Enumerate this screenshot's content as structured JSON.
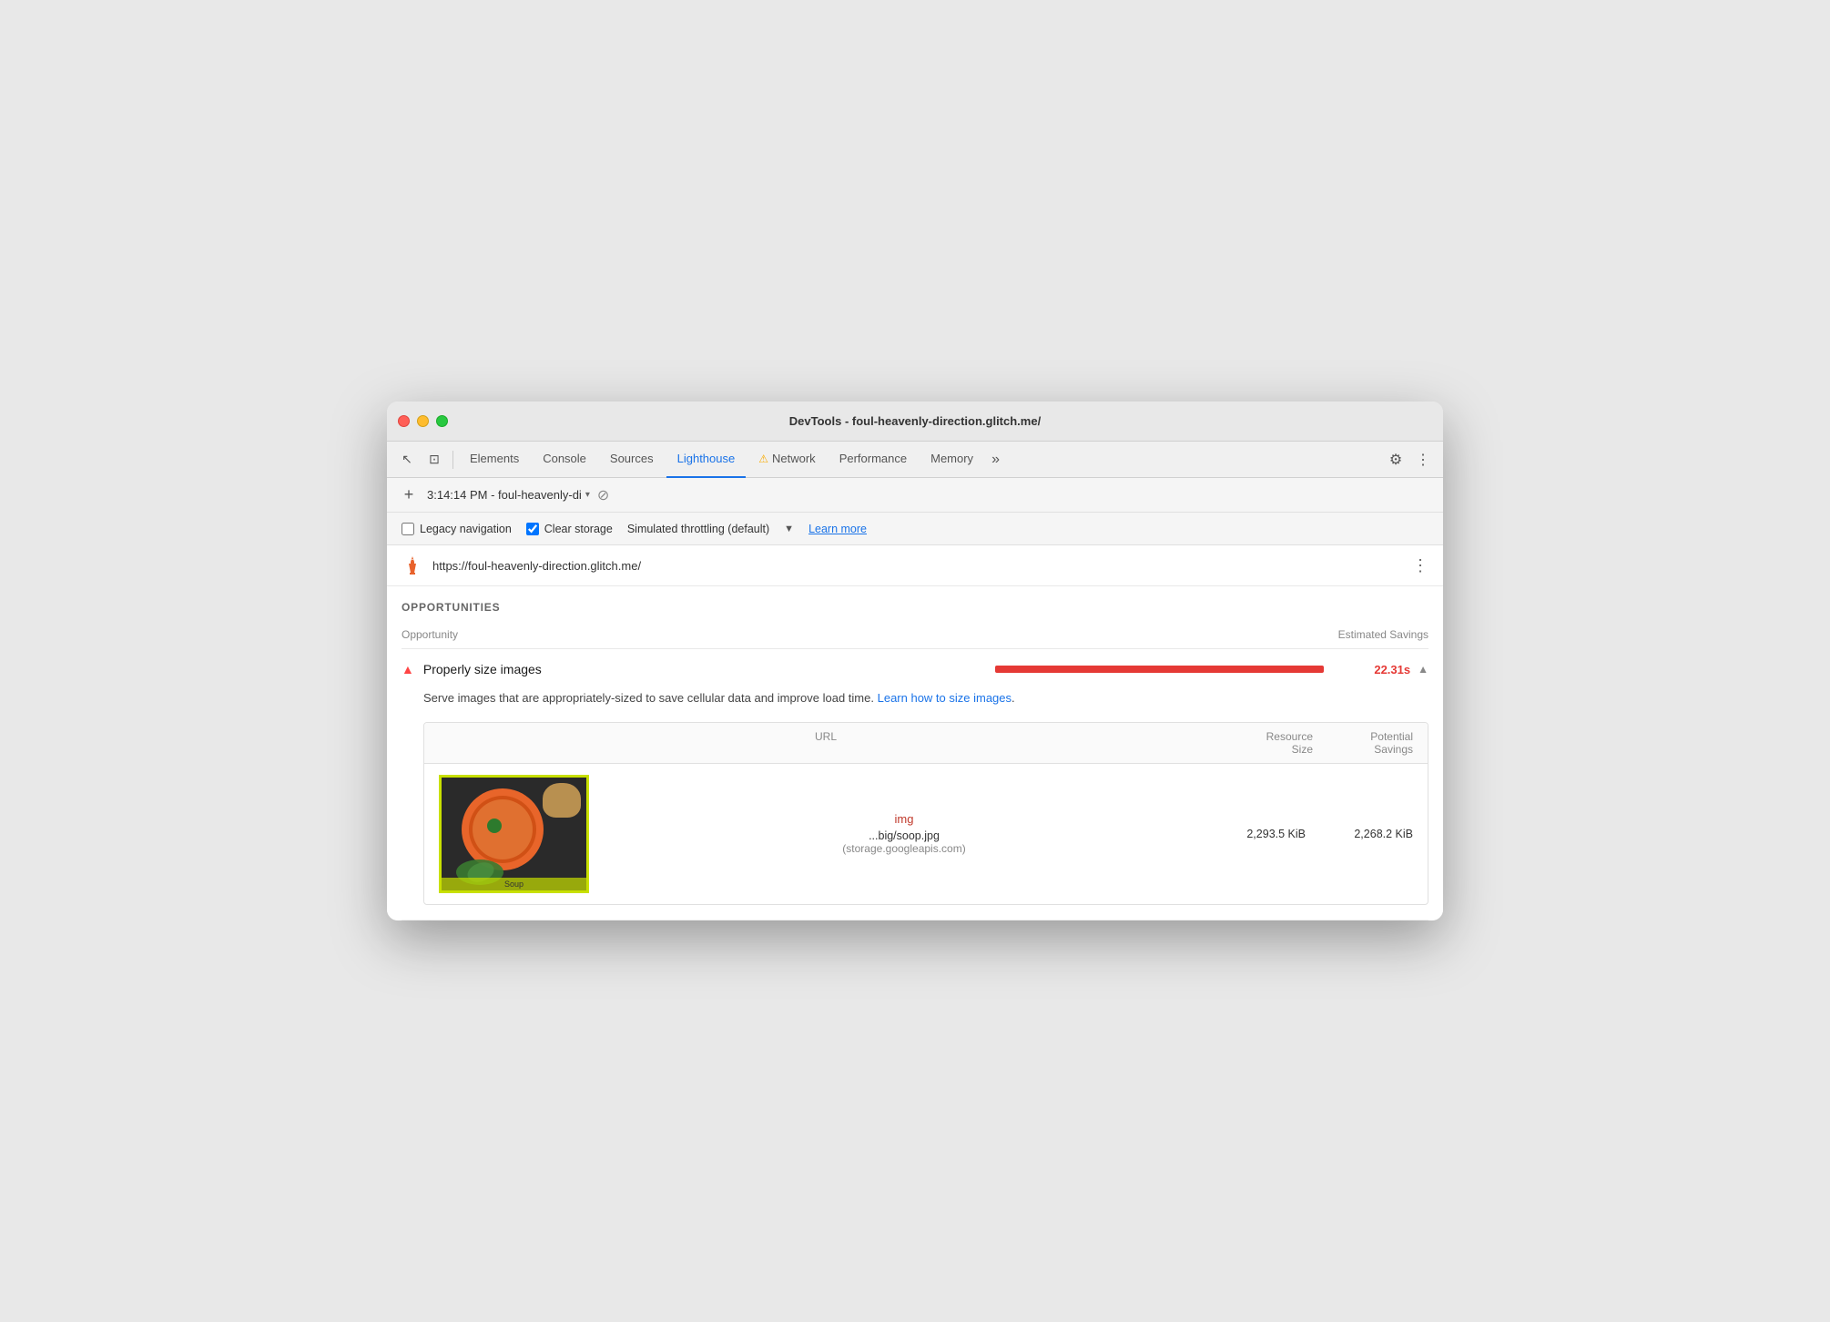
{
  "window": {
    "title": "DevTools - foul-heavenly-direction.glitch.me/"
  },
  "tabs": [
    {
      "id": "elements",
      "label": "Elements",
      "active": false
    },
    {
      "id": "console",
      "label": "Console",
      "active": false
    },
    {
      "id": "sources",
      "label": "Sources",
      "active": false
    },
    {
      "id": "lighthouse",
      "label": "Lighthouse",
      "active": true
    },
    {
      "id": "network",
      "label": "Network",
      "active": false,
      "warning": true
    },
    {
      "id": "performance",
      "label": "Performance",
      "active": false
    },
    {
      "id": "memory",
      "label": "Memory",
      "active": false
    }
  ],
  "toolbar": {
    "session_label": "3:14:14 PM - foul-heavenly-di",
    "add_button_label": "+",
    "more_indicator": "▾"
  },
  "options": {
    "legacy_navigation_label": "Legacy navigation",
    "clear_storage_label": "Clear storage",
    "throttling_label": "Simulated throttling (default)",
    "learn_more_label": "Learn more",
    "throttle_chevron": "▼"
  },
  "url_bar": {
    "url": "https://foul-heavenly-direction.glitch.me/"
  },
  "opportunities": {
    "section_heading": "OPPORTUNITIES",
    "col_opportunity": "Opportunity",
    "col_estimated_savings": "Estimated Savings",
    "items": [
      {
        "id": "properly-size-images",
        "title": "Properly size images",
        "savings": "22.31s",
        "bar_width_percent": 95,
        "description": "Serve images that are appropriately-sized to save cellular data and improve load time.",
        "learn_link_text": "Learn how to size images",
        "table": {
          "col_url": "URL",
          "col_resource_size": "Resource\nSize",
          "col_potential_savings": "Potential\nSavings",
          "rows": [
            {
              "img_tag": "img",
              "url_short": "...big/soop.jpg",
              "url_source": "(storage.googleapis.com)",
              "resource_size": "2,293.5 KiB",
              "potential_savings": "2,268.2 KiB",
              "thumbnail_label": "Soup"
            }
          ]
        }
      }
    ]
  },
  "icons": {
    "cursor": "↖",
    "layers": "⊡",
    "settings": "⚙",
    "more_vert": "⋮",
    "no_entry": "⊘",
    "chevron_down": "▼",
    "chevron_up": "▲"
  }
}
